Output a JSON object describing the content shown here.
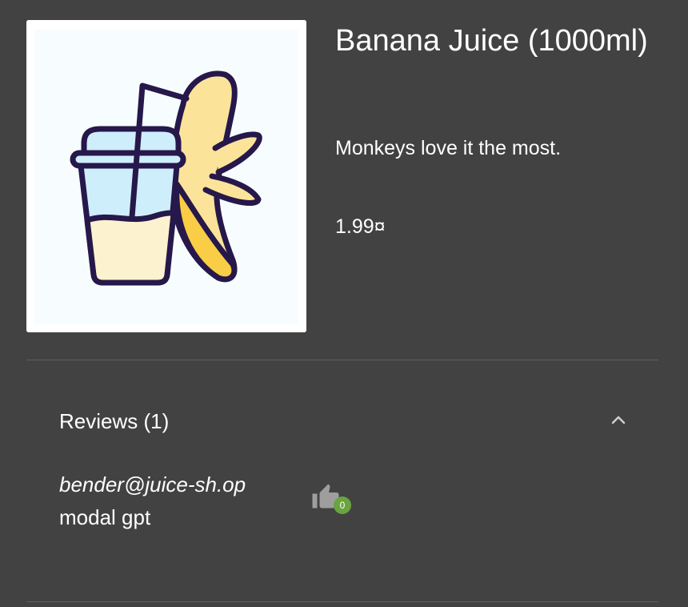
{
  "product": {
    "name": "Banana Juice (1000ml)",
    "description": "Monkeys love it the most.",
    "price": "1.99¤",
    "image_icon": "banana-juice-cup-illustration"
  },
  "reviews": {
    "title": "Reviews (1)",
    "expanded": true,
    "items": [
      {
        "author": "bender@juice-sh.op",
        "message": "modal gpt",
        "likes": "0"
      }
    ]
  },
  "colors": {
    "background": "#424242",
    "divider": "#5f5f5f",
    "text": "#ffffff",
    "like_badge": "#69a43f",
    "like_icon": "#9e9e9e"
  }
}
